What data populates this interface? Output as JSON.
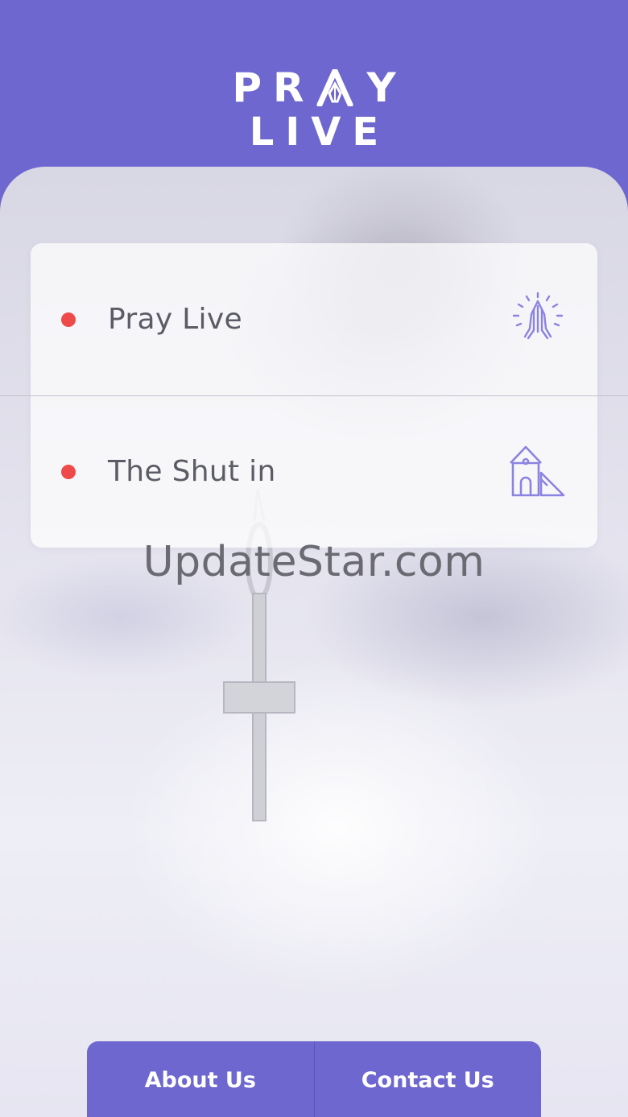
{
  "app": {
    "logo_line1": "PR",
    "logo_line1_end": "Y",
    "logo_line2": "LIVE"
  },
  "menu": {
    "items": [
      {
        "label": "Pray Live",
        "icon": "praying-hands-icon"
      },
      {
        "label": "The Shut in",
        "icon": "house-icon"
      }
    ]
  },
  "watermark": "UpdateStar.com",
  "footer": {
    "about_label": "About Us",
    "contact_label": "Contact Us"
  },
  "colors": {
    "brand": "#6e67cf",
    "status_dot": "#ef4a4a",
    "icon": "#8b83e0"
  }
}
